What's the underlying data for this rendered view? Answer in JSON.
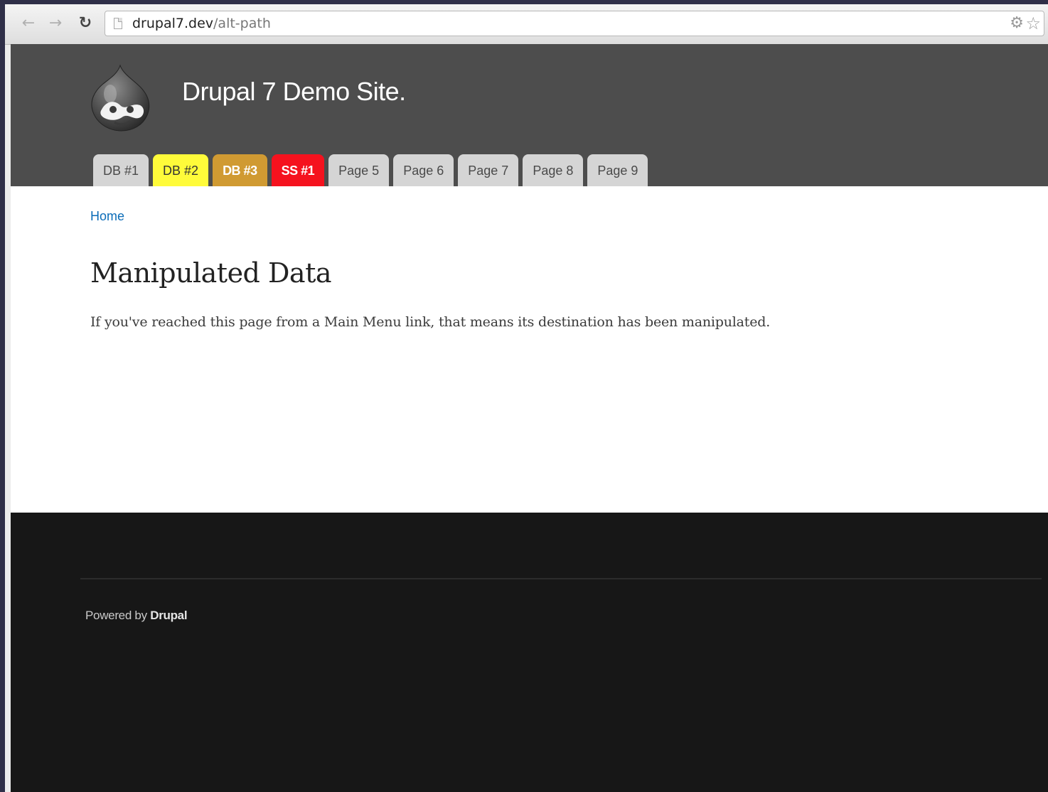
{
  "browser": {
    "url_host": "drupal7.dev",
    "url_path": "/alt-path",
    "back_icon": "back-arrow-icon",
    "forward_icon": "forward-arrow-icon",
    "reload_icon": "reload-icon",
    "extension_icon": "gear-icon",
    "bookmark_icon": "star-icon"
  },
  "header": {
    "site_name": "Drupal 7 Demo Site.",
    "logo_icon": "drupal-drop-icon",
    "background": "#4d4d4d"
  },
  "menu": {
    "items": [
      {
        "label": "DB #1",
        "color": "#d5d5d5"
      },
      {
        "label": "DB #2",
        "color": "#fffb3a"
      },
      {
        "label": "DB #3",
        "color": "#d09a32"
      },
      {
        "label": "SS #1",
        "color": "#f5121e"
      },
      {
        "label": "Page 5",
        "color": "#d5d5d5"
      },
      {
        "label": "Page 6",
        "color": "#d5d5d5"
      },
      {
        "label": "Page 7",
        "color": "#d5d5d5"
      },
      {
        "label": "Page 8",
        "color": "#d5d5d5"
      },
      {
        "label": "Page 9",
        "color": "#d5d5d5"
      }
    ]
  },
  "content": {
    "breadcrumb": "Home",
    "title": "Manipulated Data",
    "body": "If you've reached this page from a Main Menu link, that means its destination has been manipulated."
  },
  "footer": {
    "powered_prefix": "Powered by",
    "powered_link": "Drupal",
    "background": "#171717"
  }
}
